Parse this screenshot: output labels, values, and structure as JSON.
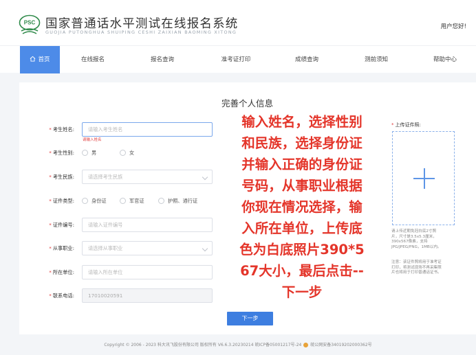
{
  "header": {
    "logo_text": "PSC",
    "title": "国家普通话水平测试在线报名系统",
    "pinyin": "GUOJIA PUTONGHUA SHUIPING CESHI ZAIXIAN BAOMING XITONG",
    "user_greeting": "用户您好!"
  },
  "nav": {
    "items": [
      {
        "label": "首页"
      },
      {
        "label": "在线报名"
      },
      {
        "label": "报名查询"
      },
      {
        "label": "准考证打印"
      },
      {
        "label": "成绩查询"
      },
      {
        "label": "测前须知"
      },
      {
        "label": "帮助中心"
      }
    ]
  },
  "form": {
    "title": "完善个人信息",
    "name": {
      "label": "考生姓名:",
      "placeholder": "请输入考生姓名",
      "error": "请输入姓名"
    },
    "gender": {
      "label": "考生性别:",
      "options": [
        "男",
        "女"
      ]
    },
    "ethnicity": {
      "label": "考生民族:",
      "placeholder": "请选择考生民族"
    },
    "id_type": {
      "label": "证件类型:",
      "options": [
        "身份证",
        "军官证",
        "护照、通行证"
      ]
    },
    "id_number": {
      "label": "证件编号:",
      "placeholder": "请输入证件编号"
    },
    "occupation": {
      "label": "从事职业:",
      "placeholder": "请选择从事职业"
    },
    "workplace": {
      "label": "所在单位:",
      "placeholder": "请输入所在单位"
    },
    "phone": {
      "label": "联系电话:",
      "value": "17010020591"
    },
    "next_button": "下一步"
  },
  "instructions": {
    "lines": [
      "输入姓名，选择性别",
      "和民族，选择身份证",
      "并输入正确的身份证",
      "号码，从事职业根据",
      "你现在情况选择，输",
      "入所在单位，上传底",
      "色为白底照片390*5",
      "67大小，最后点击--",
      "下一步"
    ]
  },
  "upload": {
    "label": "上传证件照:",
    "note1": [
      "请上传近期免冠白底2寸照",
      "片，尺寸是3.5x5.3厘米，",
      "390x567像素，支持",
      "JPG/JPEG/PNG，1MB以内。"
    ],
    "note2": [
      "注意：该证件照将用于准考证",
      "打印，将测试现场不再采集照",
      "片也将用于打印普通话证书。"
    ]
  },
  "footer": {
    "copyright": "Copyright © 2006 - 2023 科大讯飞股份有限公司 版权所有 V6.6.3.20230214  皖ICP备05001217号-24",
    "police": "皖公网安备34019202000362号"
  },
  "colors": {
    "accent": "#3d7ee0",
    "overlay_red": "#e4352a",
    "required": "#e03b3b"
  }
}
